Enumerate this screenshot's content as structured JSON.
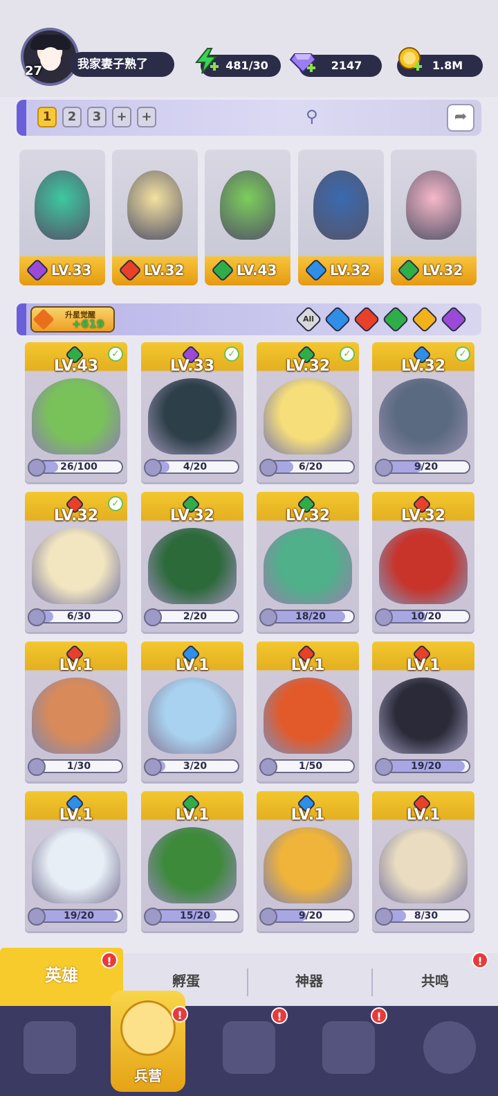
{
  "player": {
    "name": "我家妻子熟了",
    "level": "27"
  },
  "resources": {
    "energy": "481/30",
    "gems": "2147",
    "gold": "1.8M"
  },
  "team_tabs": [
    "1",
    "2",
    "3",
    "+",
    "+"
  ],
  "team_active": "1",
  "team": [
    {
      "level": "LV.33",
      "element": "dark"
    },
    {
      "level": "LV.32",
      "element": "fire"
    },
    {
      "level": "LV.43",
      "element": "wind"
    },
    {
      "level": "LV.32",
      "element": "water"
    },
    {
      "level": "LV.32",
      "element": "wind"
    }
  ],
  "awaken": {
    "label": "升星觉醒",
    "value": "+619"
  },
  "filters": [
    "All",
    "water",
    "fire",
    "wind",
    "light",
    "dark"
  ],
  "heroes": [
    {
      "level": "LV.43",
      "element": "wind",
      "shards": "26/100",
      "fill": 0.26,
      "owned_check": true
    },
    {
      "level": "LV.33",
      "element": "dark",
      "shards": "4/20",
      "fill": 0.2,
      "owned_check": true
    },
    {
      "level": "LV.32",
      "element": "wind",
      "shards": "6/20",
      "fill": 0.3,
      "owned_check": true
    },
    {
      "level": "LV.32",
      "element": "water",
      "shards": "9/20",
      "fill": 0.45,
      "owned_check": true
    },
    {
      "level": "LV.32",
      "element": "fire",
      "shards": "6/30",
      "fill": 0.2,
      "owned_check": true
    },
    {
      "level": "LV.32",
      "element": "wind",
      "shards": "2/20",
      "fill": 0.1,
      "owned_check": false
    },
    {
      "level": "LV.32",
      "element": "wind",
      "shards": "18/20",
      "fill": 0.9,
      "owned_check": false
    },
    {
      "level": "LV.32",
      "element": "fire",
      "shards": "10/20",
      "fill": 0.5,
      "owned_check": false
    },
    {
      "level": "LV.1",
      "element": "fire",
      "shards": "1/30",
      "fill": 0.03,
      "owned_check": false
    },
    {
      "level": "LV.1",
      "element": "water",
      "shards": "3/20",
      "fill": 0.15,
      "owned_check": false
    },
    {
      "level": "LV.1",
      "element": "fire",
      "shards": "1/50",
      "fill": 0.02,
      "owned_check": false
    },
    {
      "level": "LV.1",
      "element": "fire",
      "shards": "19/20",
      "fill": 0.95,
      "owned_check": false
    },
    {
      "level": "LV.1",
      "element": "water",
      "shards": "19/20",
      "fill": 0.95,
      "owned_check": false
    },
    {
      "level": "LV.1",
      "element": "wind",
      "shards": "15/20",
      "fill": 0.75,
      "owned_check": false
    },
    {
      "level": "LV.1",
      "element": "water",
      "shards": "9/20",
      "fill": 0.45,
      "owned_check": false
    },
    {
      "level": "LV.1",
      "element": "fire",
      "shards": "8/30",
      "fill": 0.27,
      "owned_check": false
    }
  ],
  "subtabs": [
    {
      "label": "英雄",
      "badge": "!"
    },
    {
      "label": "孵蛋",
      "badge": ""
    },
    {
      "label": "神器",
      "badge": ""
    },
    {
      "label": "共鸣",
      "badge": "!"
    }
  ],
  "nav": {
    "active_label": "兵营",
    "badge": "!"
  },
  "element_colors": {
    "fire": "#e8412a",
    "water": "#2f8fe6",
    "wind": "#2fae48",
    "dark": "#9a4ad6",
    "light": "#f2b21a"
  }
}
